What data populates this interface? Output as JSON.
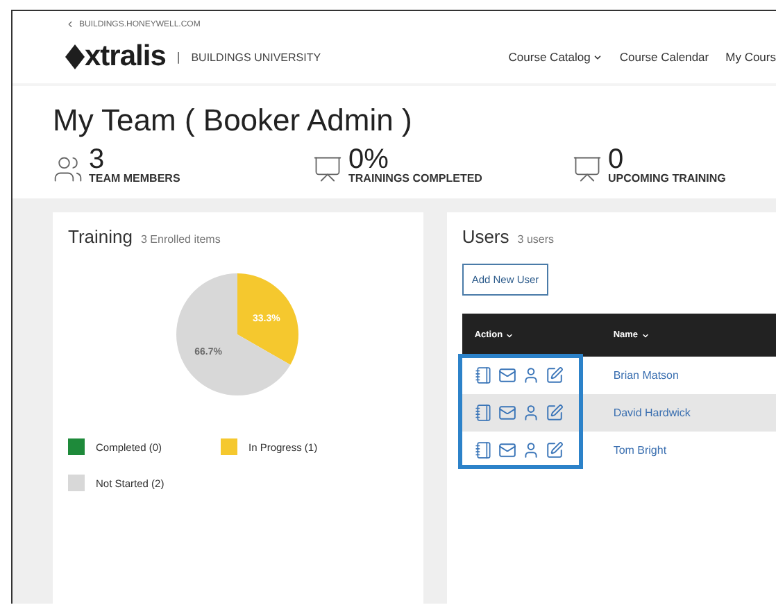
{
  "breadcrumb": "BUILDINGS.HONEYWELL.COM",
  "brand": {
    "logo": "xtralis",
    "divider": "|",
    "subtitle": "BUILDINGS UNIVERSITY"
  },
  "nav": [
    {
      "label": "Course Catalog",
      "dropdown": true
    },
    {
      "label": "Course Calendar",
      "dropdown": false
    },
    {
      "label": "My Cours",
      "dropdown": false
    }
  ],
  "page_title": "My Team ( Booker Admin )",
  "stats": [
    {
      "kind": "team",
      "value": "3",
      "label": "TEAM MEMBERS"
    },
    {
      "kind": "training",
      "value": "0%",
      "label": "TRAININGS COMPLETED"
    },
    {
      "kind": "training",
      "value": "0",
      "label": "UPCOMING TRAINING"
    }
  ],
  "training": {
    "title": "Training",
    "subtitle": "3 Enrolled items",
    "chart_data": {
      "type": "pie",
      "categories": [
        "Completed (0)",
        "In Progress (1)",
        "Not Started (2)"
      ],
      "values": [
        0,
        33.3,
        66.7
      ],
      "value_labels": [
        null,
        "33.3%",
        "66.7%"
      ]
    },
    "legend": [
      {
        "color": "#1e8a3a"
      },
      {
        "color": "#f5c82e"
      },
      {
        "color": "#d8d8d8"
      }
    ]
  },
  "users": {
    "title": "Users",
    "subtitle": "3 users",
    "add_button": "Add New User",
    "columns": [
      {
        "label": "Action"
      },
      {
        "label": "Name"
      }
    ],
    "rows": [
      {
        "name": "Brian Matson",
        "selected": false
      },
      {
        "name": "David Hardwick",
        "selected": true
      },
      {
        "name": "Tom Bright",
        "selected": false
      }
    ],
    "highlight_actions": true
  }
}
